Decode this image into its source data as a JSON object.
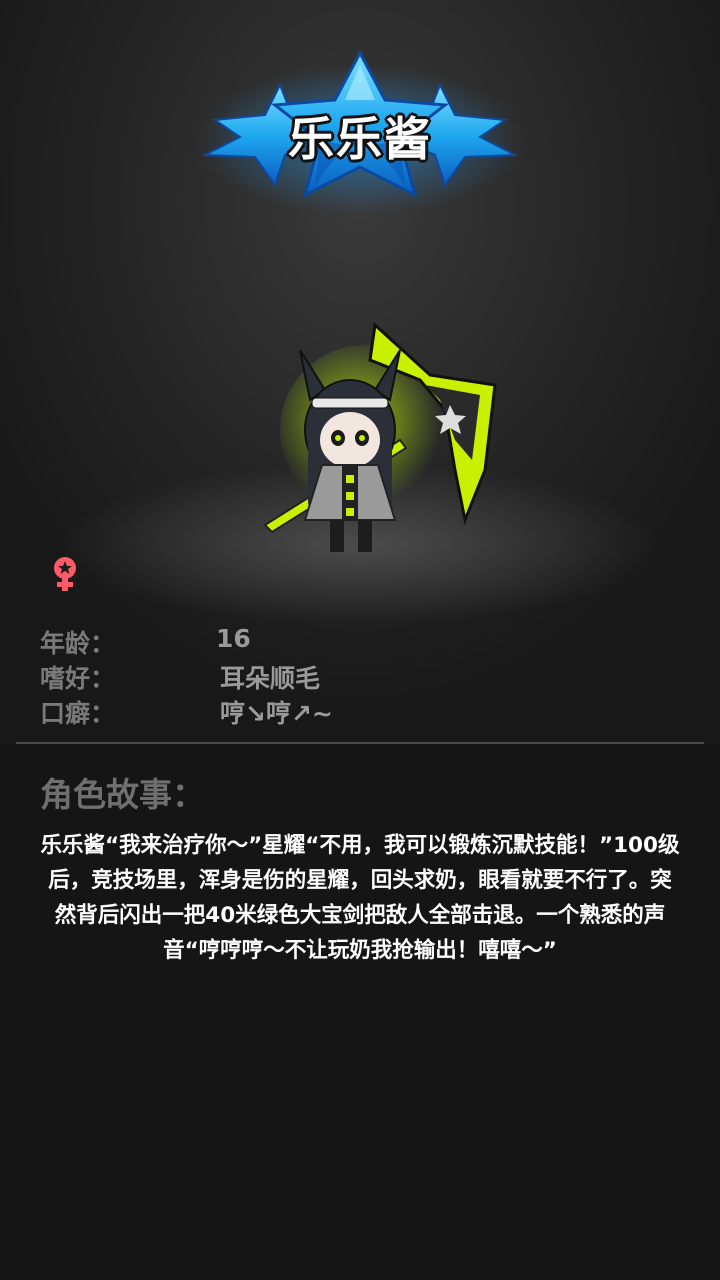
{
  "character": {
    "name": "乐乐酱",
    "gender_icon": "female-icon"
  },
  "profile": {
    "age_label": "年龄：",
    "age_value": "16",
    "hobby_label": "嗜好：",
    "hobby_value": "耳朵顺毛",
    "catchphrase_label": "口癖：",
    "catchphrase_value": "哼↘哼↗~"
  },
  "story": {
    "heading": "角色故事：",
    "text": "乐乐酱“我来治疗你～”星耀“不用，我可以锻炼沉默技能！”100级后，竞技场里，浑身是伤的星耀，回头求奶，眼看就要不行了。突然背后闪出一把40米绿色大宝剑把敌人全部击退。一个熟悉的声音“哼哼哼～不让玩奶我抢输出！嘻嘻～”"
  },
  "colors": {
    "badge_blue": "#1fa8f0",
    "weapon_green": "#c8f000",
    "gender_pink": "#ff5a68"
  }
}
